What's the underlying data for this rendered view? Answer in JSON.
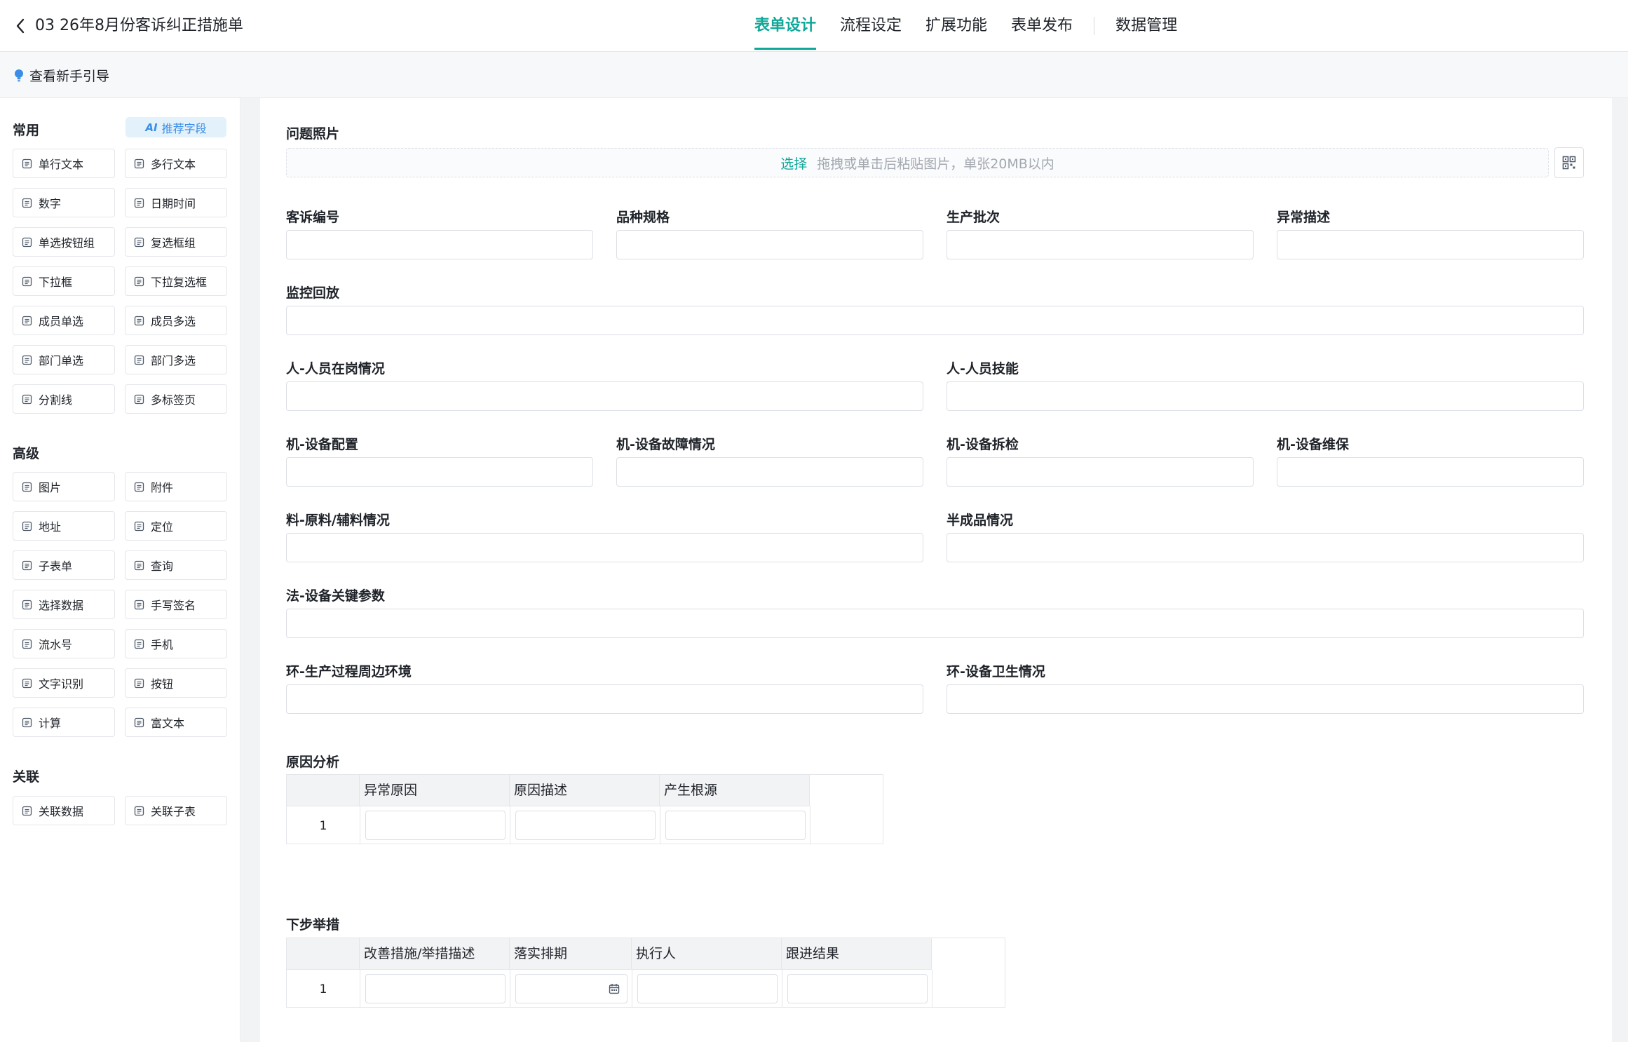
{
  "header": {
    "title": "03 26年8月份客诉纠正措施单",
    "tabs": [
      {
        "label": "表单设计",
        "active": true
      },
      {
        "label": "流程设定",
        "active": false
      },
      {
        "label": "扩展功能",
        "active": false
      },
      {
        "label": "表单发布",
        "active": false
      },
      {
        "label": "数据管理",
        "active": false
      }
    ]
  },
  "guide": {
    "label": "查看新手引导"
  },
  "sidebar": {
    "common_title": "常用",
    "ai_badge": {
      "mark": "AI",
      "label": "推荐字段"
    },
    "common_items": [
      {
        "label": "单行文本",
        "icon": "single-line-text-icon"
      },
      {
        "label": "多行文本",
        "icon": "multi-line-text-icon"
      },
      {
        "label": "数字",
        "icon": "number-icon"
      },
      {
        "label": "日期时间",
        "icon": "calendar-icon"
      },
      {
        "label": "单选按钮组",
        "icon": "radio-icon"
      },
      {
        "label": "复选框组",
        "icon": "checkbox-group-icon"
      },
      {
        "label": "下拉框",
        "icon": "dropdown-icon"
      },
      {
        "label": "下拉复选框",
        "icon": "dropdown-multi-icon"
      },
      {
        "label": "成员单选",
        "icon": "member-icon"
      },
      {
        "label": "成员多选",
        "icon": "members-icon"
      },
      {
        "label": "部门单选",
        "icon": "department-icon"
      },
      {
        "label": "部门多选",
        "icon": "departments-icon"
      },
      {
        "label": "分割线",
        "icon": "divider-icon"
      },
      {
        "label": "多标签页",
        "icon": "tabs-icon"
      }
    ],
    "advanced_title": "高级",
    "advanced_items": [
      {
        "label": "图片",
        "icon": "image-icon"
      },
      {
        "label": "附件",
        "icon": "attachment-icon"
      },
      {
        "label": "地址",
        "icon": "address-pin-icon"
      },
      {
        "label": "定位",
        "icon": "locate-icon"
      },
      {
        "label": "子表单",
        "icon": "subform-icon"
      },
      {
        "label": "查询",
        "icon": "query-icon"
      },
      {
        "label": "选择数据",
        "icon": "database-icon"
      },
      {
        "label": "手写签名",
        "icon": "pen-icon"
      },
      {
        "label": "流水号",
        "icon": "serial-number-icon"
      },
      {
        "label": "手机",
        "icon": "phone-icon"
      },
      {
        "label": "文字识别",
        "icon": "ocr-icon"
      },
      {
        "label": "按钮",
        "icon": "button-icon"
      },
      {
        "label": "计算",
        "icon": "calculator-icon"
      },
      {
        "label": "富文本",
        "icon": "rich-text-icon"
      }
    ],
    "related_title": "关联",
    "related_items": [
      {
        "label": "关联数据",
        "icon": "link-data-icon"
      },
      {
        "label": "关联子表",
        "icon": "link-subtable-icon"
      }
    ]
  },
  "form": {
    "photo": {
      "label": "问题照片",
      "choose": "选择",
      "hint": "拖拽或单击后粘贴图片，单张20MB以内"
    },
    "fields": {
      "complaint_no": "客诉编号",
      "spec": "品种规格",
      "batch": "生产批次",
      "abnormal_desc": "异常描述",
      "monitor": "监控回放",
      "staff_onduty": "人-人员在岗情况",
      "staff_skill": "人-人员技能",
      "machine_config": "机-设备配置",
      "machine_fault": "机-设备故障情况",
      "machine_inspect": "机-设备拆检",
      "machine_maint": "机-设备维保",
      "material": "料-原料/辅料情况",
      "semi_product": "半成品情况",
      "method_params": "法-设备关键参数",
      "env_process": "环-生产过程周边环境",
      "env_hygiene": "环-设备卫生情况"
    },
    "cause_table": {
      "label": "原因分析",
      "columns": [
        "异常原因",
        "原因描述",
        "产生根源"
      ],
      "rows": [
        "1"
      ]
    },
    "next_table": {
      "label": "下步举措",
      "columns": [
        "改善措施/举措描述",
        "落实排期",
        "执行人",
        "跟进结果"
      ],
      "rows": [
        "1"
      ]
    }
  }
}
